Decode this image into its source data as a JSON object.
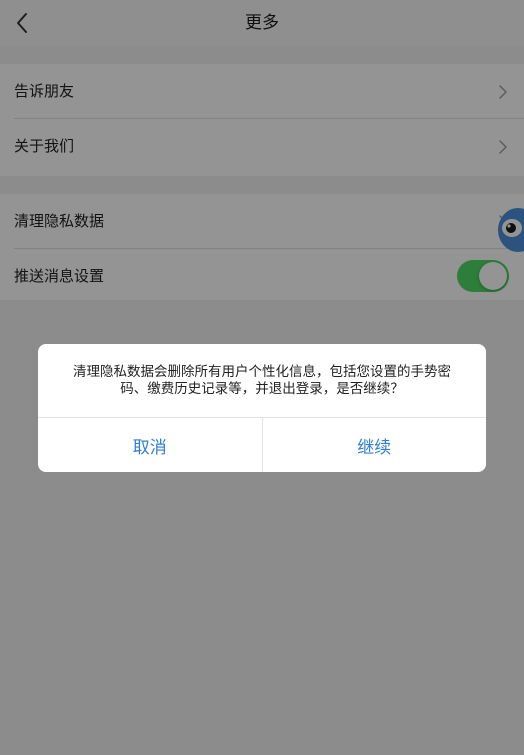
{
  "header": {
    "title": "更多",
    "back_icon": "chevron-left-icon"
  },
  "groups": [
    {
      "items": [
        {
          "label": "告诉朋友",
          "icon": "chevron-right-icon"
        },
        {
          "label": "关于我们",
          "icon": "chevron-right-icon"
        }
      ]
    },
    {
      "items": [
        {
          "label": "清理隐私数据",
          "icon": "chevron-right-icon"
        },
        {
          "label": "推送消息设置",
          "toggle": "on"
        }
      ]
    }
  ],
  "dialog": {
    "message": "清理隐私数据会删除所有用户个性化信息，包括您设置的手势密码、缴费历史记录等，并退出登录，是否继续？",
    "cancel_label": "取消",
    "confirm_label": "继续"
  },
  "colors": {
    "accent": "#2f7fd4",
    "toggle_on": "#4cd964"
  },
  "mascot_icon": "assistant-mascot-icon"
}
